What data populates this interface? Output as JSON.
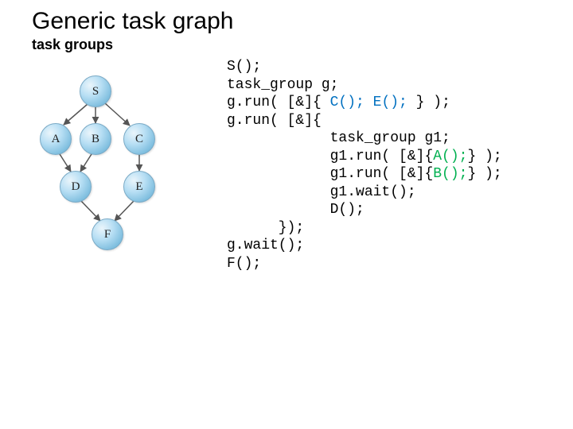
{
  "title": "Generic task graph",
  "subtitle": "task groups",
  "graph": {
    "nodes": {
      "S": "S",
      "A": "A",
      "B": "B",
      "C": "C",
      "D": "D",
      "E": "E",
      "F": "F"
    }
  },
  "code": {
    "l1": "S();",
    "l2a": "task_group",
    "l2b": " g;",
    "l3a": "g.run( [&]{ ",
    "l3b": "C();",
    "l3c": " ",
    "l3d": "E();",
    "l3e": " } );",
    "l4": "g.run( [&]{",
    "l5a": "            ",
    "l5b": "task_group",
    "l5c": " g1;",
    "l6a": "            g1.run( [&]{",
    "l6b": "A();",
    "l6c": "} );",
    "l7a": "            g1.run( [&]{",
    "l7b": "B();",
    "l7c": "} );",
    "l8": "            g1.wait();",
    "l9": "            D();",
    "l10": "      });",
    "l11": "g.wait();",
    "l12": "F();"
  }
}
